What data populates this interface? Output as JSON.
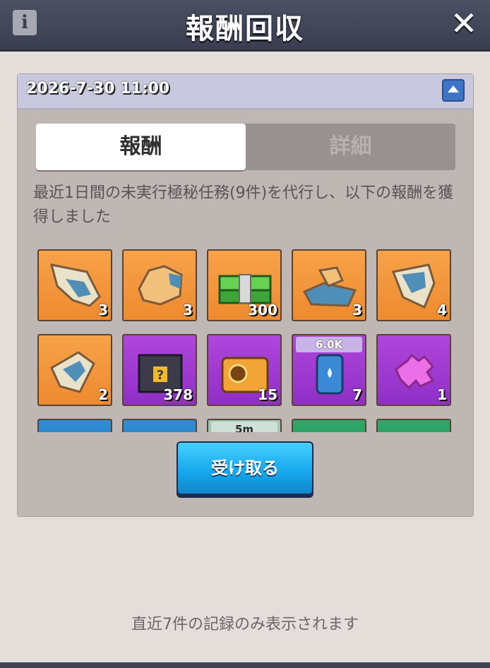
{
  "header": {
    "title": "報酬回収",
    "info_icon": "info-icon",
    "close_icon": "close-icon"
  },
  "record": {
    "date": "2026-7-30 11:00"
  },
  "tabs": [
    {
      "label": "報酬",
      "active": true
    },
    {
      "label": "詳細",
      "active": false
    }
  ],
  "description": "最近1日間の未実行極秘任務(9件)を代行し、以下の報酬を獲得しました",
  "rewards": [
    {
      "icon": "map-fragment-icon",
      "qty": "3"
    },
    {
      "icon": "map-fragment-icon",
      "qty": "3"
    },
    {
      "icon": "cash-stack-icon",
      "qty": "300"
    },
    {
      "icon": "map-fragment-icon",
      "qty": "3"
    },
    {
      "icon": "map-fragment-icon",
      "qty": "4"
    },
    {
      "icon": "map-fragment-icon",
      "qty": "2"
    },
    {
      "icon": "mystery-box-icon",
      "qty": "378"
    },
    {
      "icon": "treasure-chest-icon",
      "qty": "15"
    },
    {
      "icon": "water-barrel-icon",
      "qty": "7",
      "badge": "6.0K"
    },
    {
      "icon": "puzzle-piece-icon",
      "qty": "1"
    }
  ],
  "partial_rewards": {
    "badge": "5m"
  },
  "claim_label": "受け取る",
  "footer": "直近7件の記録のみ表示されます",
  "colors": {
    "header": "#3f4355",
    "tab_active": "#ffffff",
    "claim": "#17a9ee",
    "rarity_orange": "#f39a3e",
    "rarity_purple": "#a03fd6"
  }
}
